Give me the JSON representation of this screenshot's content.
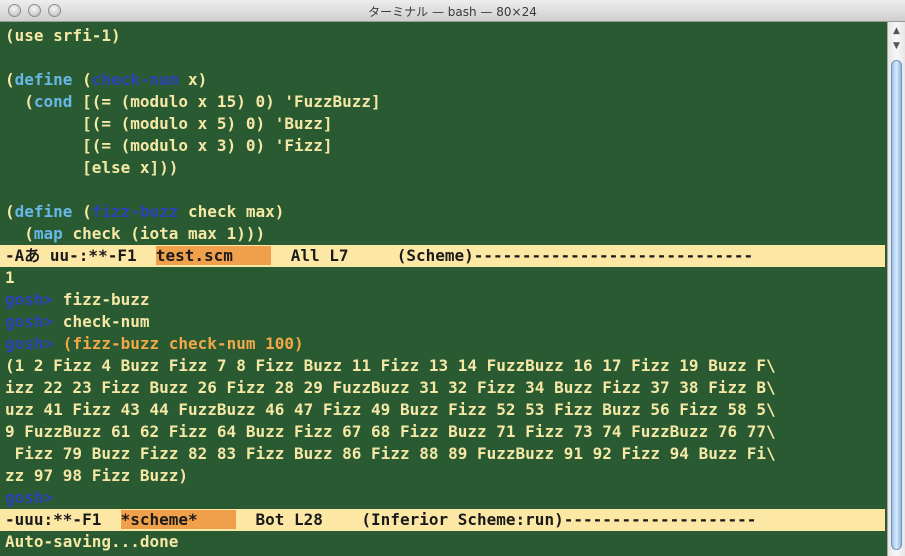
{
  "window": {
    "title": "ターミナル — bash — 80×24"
  },
  "editor": {
    "line1": "(use srfi-1)",
    "line3_kw": "define",
    "line3_fn": "check-num",
    "line3_rest": " x)",
    "line4_kw": "cond",
    "line4_rest": " [(= (modulo x 15) 0) 'FuzzBuzz]",
    "line5": "        [(= (modulo x 5) 0) 'Buzz]",
    "line6": "        [(= (modulo x 3) 0) 'Fizz]",
    "line7": "        [else x]))",
    "line9_kw": "define",
    "line9_fn": "fizz-buzz",
    "line9_rest": " check max)",
    "line10_kw": "map",
    "line10_rest": " check (iota max 1)))"
  },
  "modeline_top": {
    "prefix": "-Aあ uu-:**-F1  ",
    "buffer": "test.scm    ",
    "rest": "  All L7     (Scheme)-----------------------------"
  },
  "repl": {
    "output_1": "1",
    "prompt": "gosh>",
    "cmd1": " fizz-buzz",
    "cmd2": " check-num",
    "cmd3": " (fizz-buzz check-num 100)",
    "result": [
      "(1 2 Fizz 4 Buzz Fizz 7 8 Fizz Buzz 11 Fizz 13 14 FuzzBuzz 16 17 Fizz 19 Buzz F\\",
      "izz 22 23 Fizz Buzz 26 Fizz 28 29 FuzzBuzz 31 32 Fizz 34 Buzz Fizz 37 38 Fizz B\\",
      "uzz 41 Fizz 43 44 FuzzBuzz 46 47 Fizz 49 Buzz Fizz 52 53 Fizz Buzz 56 Fizz 58 5\\",
      "9 FuzzBuzz 61 62 Fizz 64 Buzz Fizz 67 68 Fizz Buzz 71 Fizz 73 74 FuzzBuzz 76 77\\",
      " Fizz 79 Buzz Fizz 82 83 Fizz Buzz 86 Fizz 88 89 FuzzBuzz 91 92 Fizz 94 Buzz Fi\\",
      "zz 97 98 Fizz Buzz)"
    ]
  },
  "modeline_bottom": {
    "prefix": "-uuu:**-F1  ",
    "buffer": "*scheme*    ",
    "rest": "  Bot L28    (Inferior Scheme:run)--------------------"
  },
  "echo_area": "Auto-saving...done",
  "colors": {
    "background": "#2a5a32",
    "text": "#f5e8a6",
    "keyword": "#67b8e6",
    "function_name": "#2a44b8",
    "prompt": "#2a44b8",
    "input": "#f0a848",
    "modeline": "#fce7a4",
    "modeline_buffer": "#f0a04a"
  }
}
